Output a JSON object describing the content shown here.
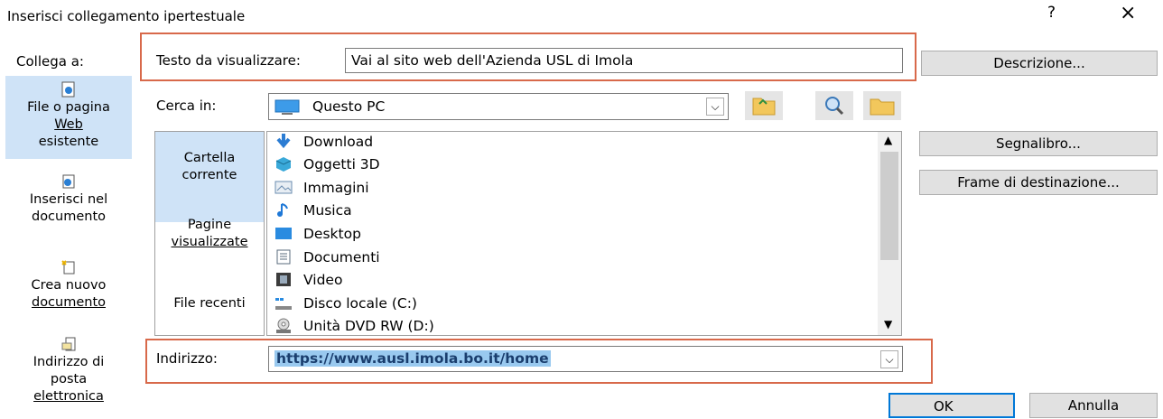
{
  "dialog": {
    "title": "Inserisci collegamento ipertestuale",
    "help": "?",
    "close": "×"
  },
  "link_to": {
    "label": "Collega a:",
    "items": [
      {
        "line1": "File o pagina",
        "line2": "Web",
        "line3": "esistente",
        "icon": "file-web-icon",
        "active": true
      },
      {
        "line1": "Inserisci nel",
        "line2": "documento",
        "icon": "place-in-document-icon",
        "active": false
      },
      {
        "line1": "Crea nuovo",
        "line2": "documento",
        "icon": "new-document-icon",
        "active": false
      },
      {
        "line1": "Indirizzo di",
        "line2": "posta",
        "line3": "elettronica",
        "icon": "email-address-icon",
        "active": false
      }
    ]
  },
  "text_to_display": {
    "label": "Testo da visualizzare:",
    "value": "Vai al sito web dell'Azienda USL di Imola"
  },
  "look_in": {
    "label": "Cerca in:",
    "value": "Questo PC",
    "icon": "computer-icon"
  },
  "browse_tabs": [
    {
      "line1": "Cartella",
      "line2": "corrente",
      "active": true
    },
    {
      "line1": "Pagine",
      "line2": "visualizzate",
      "active": false
    },
    {
      "line1": "File recenti",
      "active": false
    }
  ],
  "files": [
    {
      "name": "Download",
      "icon": "download-arrow-icon",
      "color": "#2b7cd3"
    },
    {
      "name": "Oggetti 3D",
      "icon": "3d-objects-icon",
      "color": "#3aa9d9"
    },
    {
      "name": "Immagini",
      "icon": "pictures-icon",
      "color": "#6a8caf"
    },
    {
      "name": "Musica",
      "icon": "music-note-icon",
      "color": "#1e78d7"
    },
    {
      "name": "Desktop",
      "icon": "desktop-icon",
      "color": "#2a8be0"
    },
    {
      "name": "Documenti",
      "icon": "documents-icon",
      "color": "#5a6b7c"
    },
    {
      "name": "Video",
      "icon": "video-icon",
      "color": "#3b3b3b"
    },
    {
      "name": "Disco locale (C:)",
      "icon": "local-disk-icon",
      "color": "#2a8be0"
    },
    {
      "name": "Unità DVD RW (D:)",
      "icon": "dvd-drive-icon",
      "color": "#777777"
    }
  ],
  "address": {
    "label": "Indirizzo:",
    "value": "https://www.ausl.imola.bo.it/home"
  },
  "buttons": {
    "description": "Descrizione...",
    "bookmark": "Segnalibro...",
    "target_frame": "Frame di destinazione...",
    "ok": "OK",
    "cancel": "Annulla"
  },
  "colors": {
    "highlight_border": "#d8694a",
    "selected_bg": "#cfe3f7",
    "selection_text_bg": "#99c9ef",
    "ok_border": "#0078d7"
  }
}
